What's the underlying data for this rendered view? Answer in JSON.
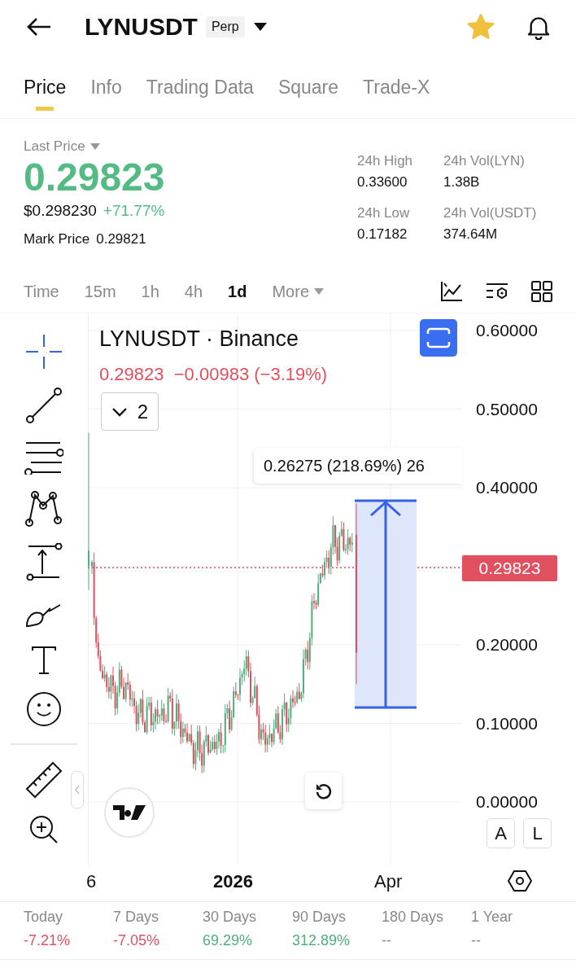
{
  "header": {
    "symbol": "LYNUSDT",
    "badge": "Perp",
    "favorite": true
  },
  "tabs": [
    {
      "label": "Price",
      "selected": true
    },
    {
      "label": "Info",
      "selected": false
    },
    {
      "label": "Trading Data",
      "selected": false
    },
    {
      "label": "Square",
      "selected": false
    },
    {
      "label": "Trade-X",
      "selected": false
    }
  ],
  "price": {
    "label": "Last Price",
    "last": "0.29823",
    "usd": "$0.298230",
    "change": "+71.77%",
    "mark_label": "Mark Price",
    "mark": "0.29821"
  },
  "stats": [
    {
      "label": "24h High",
      "value": "0.33600"
    },
    {
      "label": "24h Vol(LYN)",
      "value": "1.38B"
    },
    {
      "label": "24h Low",
      "value": "0.17182"
    },
    {
      "label": "24h Vol(USDT)",
      "value": "374.64M"
    }
  ],
  "timeframes": [
    {
      "label": "Time",
      "selected": false
    },
    {
      "label": "15m",
      "selected": false
    },
    {
      "label": "1h",
      "selected": false
    },
    {
      "label": "4h",
      "selected": false
    },
    {
      "label": "1d",
      "selected": true
    }
  ],
  "more": "More",
  "chart": {
    "title": "LYNUSDT · Binance",
    "quote": "0.29823  −0.00983 (−3.19%)",
    "indicators_count": "2",
    "measure_label": "0.26275 (218.69%) 26",
    "price_axis": [
      "0.60000",
      "0.50000",
      "0.40000",
      "0.20000",
      "0.10000",
      "0.00000"
    ],
    "current_price": "0.29823",
    "scale_buttons": [
      "A",
      "L"
    ],
    "time_axis": [
      "6",
      "2026",
      "Apr"
    ]
  },
  "performance": [
    {
      "label": "Today",
      "value": "-7.21%",
      "color": "#e0505e"
    },
    {
      "label": "7 Days",
      "value": "-7.05%",
      "color": "#e0505e"
    },
    {
      "label": "30 Days",
      "value": "69.29%",
      "color": "#4fb07e"
    },
    {
      "label": "90 Days",
      "value": "312.89%",
      "color": "#4fb07e"
    },
    {
      "label": "180 Days",
      "value": "--",
      "color": "#8a8a8a"
    },
    {
      "label": "1 Year",
      "value": "--",
      "color": "#8a8a8a"
    }
  ]
}
